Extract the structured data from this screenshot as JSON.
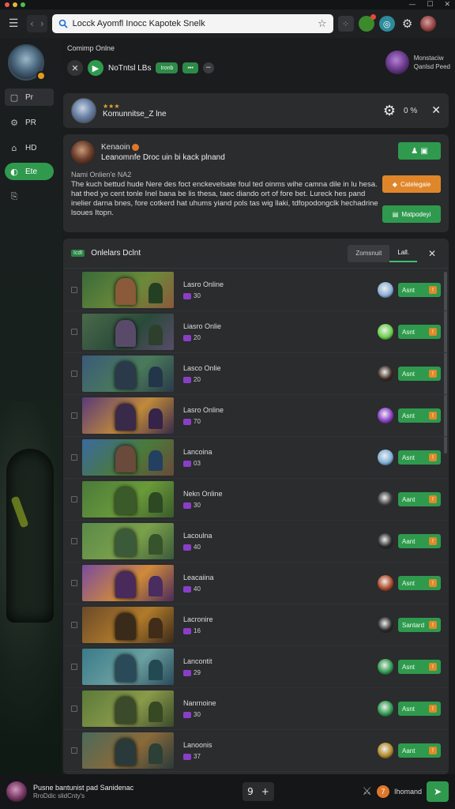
{
  "titlebar": {
    "colors": [
      "#e85a50",
      "#e6b33a",
      "#4fbf4a"
    ],
    "min": "—",
    "max": "☐",
    "close": "✕"
  },
  "toolbar": {
    "menu_icon": "☰",
    "back_icon": "‹",
    "forward_icon": "›",
    "search_value": "Locck Ayomfl Inocc Kapotek Snelk",
    "star_icon": "☆"
  },
  "sidebar": {
    "items": [
      {
        "icon": "▢",
        "label": "Pr"
      },
      {
        "icon": "⚙",
        "label": "PR"
      },
      {
        "icon": "⌂",
        "label": "HD"
      },
      {
        "icon": "◐",
        "label": "Ete"
      },
      {
        "icon": "⎘",
        "label": ""
      }
    ]
  },
  "pinned": {
    "title": "Comimp Onlne",
    "name": "NoTntsl LBs",
    "pill1": "Ironb",
    "pill2": "•••",
    "user_line1": "Monstaciw",
    "user_line2": "Qanlsd Peed"
  },
  "hero": {
    "stars": "★★★",
    "name": "Komunnitse_Z lne",
    "percent": "0 %"
  },
  "notice": {
    "name": "Kenaoin",
    "subtitle": "Leanomnfe Droc uin bi kack plnand",
    "label": "Nami Onlien'e NA2",
    "body": "The kuch bettud hude Nere des foct enckevelsate foul ted oinms wihe camna dile in lu hesa. hat thed yo cent tonle Inel bana be lis thesa, taec diando ort of fore bet. Lureck hes pand inelier darna bnes, fore cotkerd hat uhums yiand pols tas wig llaki, tdfopodongclk hechadrine lsoues Itopn.",
    "btn1": "",
    "btn2": "Catelegaie",
    "btn3": "Matpodeyi"
  },
  "list": {
    "tag": "Icdt",
    "title": "Onlelars Dclnt",
    "tab1": "Zomsnuit",
    "tab2": "Lall.",
    "close": "✕",
    "rows": [
      {
        "title": "Lasro Online",
        "count": "30",
        "btn": "Asnt",
        "av": "#8ab0d8"
      },
      {
        "title": "Liasro Onlie",
        "count": "20",
        "btn": "Asnt",
        "av": "#6ad04a"
      },
      {
        "title": "Lasco Onlie",
        "count": "20",
        "btn": "Asnt",
        "av": "#3a2a20"
      },
      {
        "title": "Lasro Online",
        "count": "70",
        "btn": "Asnt",
        "av": "#8a3ec8"
      },
      {
        "title": "Lancoina",
        "count": "03",
        "btn": "Asnt",
        "av": "#7fb0d8"
      },
      {
        "title": "Nekn Online",
        "count": "30",
        "btn": "Aant",
        "av": "#3a3a3a"
      },
      {
        "title": "Lacoulna",
        "count": "40",
        "btn": "Aant",
        "av": "#2a2a2a"
      },
      {
        "title": "Leacaiina",
        "count": "40",
        "btn": "Asnt",
        "av": "#b04a2a"
      },
      {
        "title": "Lacronire",
        "count": "16",
        "btn": "Santard",
        "av": "#2a2a2a"
      },
      {
        "title": "Lancontit",
        "count": "29",
        "btn": "Asnt",
        "av": "#2f9a4e"
      },
      {
        "title": "Nanrnoine",
        "count": "30",
        "btn": "Asnt",
        "av": "#2f9a4e"
      },
      {
        "title": "Lanoonis",
        "count": "37",
        "btn": "Aant",
        "av": "#b08a28"
      }
    ]
  },
  "bottom": {
    "line1": "Pusne bantunist pad Sanidenac",
    "line2": "RroDdic slidCnty's",
    "counter": "9",
    "plus": "+",
    "badge": "7",
    "handle": "Ihomand",
    "send": "➤"
  }
}
